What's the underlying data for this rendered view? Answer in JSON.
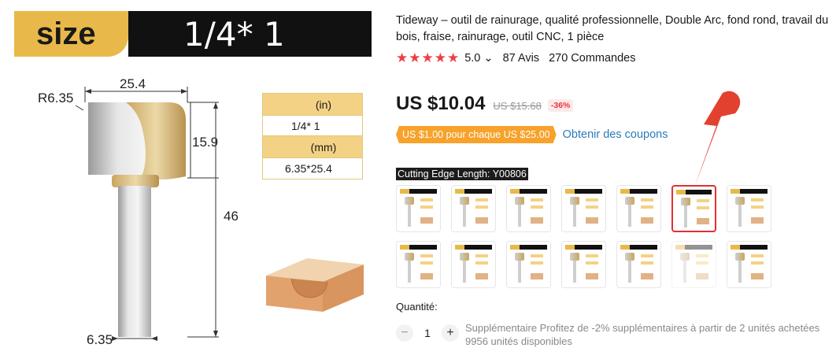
{
  "image_panel": {
    "size_label": "size",
    "size_value": "1/4* 1",
    "dims": {
      "radius": "R6.35",
      "width": "25.4",
      "height": "15.9",
      "total": "46",
      "shank": "6.35"
    },
    "spec_table": {
      "unit_in": "(in)",
      "value_in": "1/4* 1",
      "unit_mm": "(mm)",
      "value_mm": "6.35*25.4"
    }
  },
  "product": {
    "title": "Tideway – outil de rainurage, qualité professionnelle, Double Arc, fond rond, travail du bois, fraise, rainurage, outil CNC, 1 pièce",
    "stars": "★★★★★",
    "rating": "5.0",
    "rating_chevron": "⌄",
    "reviews": "87 Avis",
    "orders": "270 Commandes",
    "price": "US $10.04",
    "old_price": "US $15.68",
    "discount": "-36%",
    "coupon_tag": "US $1.00 pour chaque US $25.00",
    "coupon_link": "Obtenir des coupons",
    "variant_label": "Cutting Edge Length: Y00806",
    "variant_count_row1": 7,
    "variant_count_row2": 7,
    "selected_variant": 6,
    "disabled_variant": 13,
    "quantity_label": "Quantité:",
    "quantity_minus": "−",
    "quantity_value": "1",
    "quantity_plus": "+",
    "quantity_note_1": "Supplémentaire Profitez de -2% supplémentaires à partir de 2 unités achetées",
    "quantity_note_2": "9956 unités disponibles"
  },
  "colors": {
    "accent_red": "#ee3e43",
    "gold": "#e8b94a",
    "coupon_orange": "#f7a22b",
    "link_blue": "#2b7bb9"
  }
}
